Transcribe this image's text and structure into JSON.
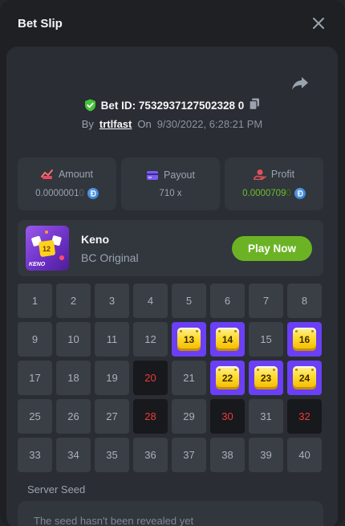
{
  "modal": {
    "title": "Bet Slip"
  },
  "bet": {
    "id_label": "Bet ID: 7532937127502328 0",
    "by_label": "By",
    "username": "trtlfast",
    "on_label": "On",
    "date": "9/30/2022, 6:28:21 PM"
  },
  "stats": {
    "amount": {
      "label": "Amount",
      "value_main": "0.0000001",
      "value_tail": "0"
    },
    "payout": {
      "label": "Payout",
      "value": "710 x"
    },
    "profit": {
      "label": "Profit",
      "value_main": "0.0000709",
      "value_tail": "0"
    }
  },
  "game": {
    "name": "Keno",
    "subtitle": "BC Original",
    "play_label": "Play Now",
    "thumb_text": "KENO"
  },
  "grid": {
    "cells": [
      {
        "n": "1",
        "state": "normal"
      },
      {
        "n": "2",
        "state": "normal"
      },
      {
        "n": "3",
        "state": "normal"
      },
      {
        "n": "4",
        "state": "normal"
      },
      {
        "n": "5",
        "state": "normal"
      },
      {
        "n": "6",
        "state": "normal"
      },
      {
        "n": "7",
        "state": "normal"
      },
      {
        "n": "8",
        "state": "normal"
      },
      {
        "n": "9",
        "state": "normal"
      },
      {
        "n": "10",
        "state": "normal"
      },
      {
        "n": "11",
        "state": "normal"
      },
      {
        "n": "12",
        "state": "normal"
      },
      {
        "n": "13",
        "state": "hit"
      },
      {
        "n": "14",
        "state": "hit"
      },
      {
        "n": "15",
        "state": "normal"
      },
      {
        "n": "16",
        "state": "hit"
      },
      {
        "n": "17",
        "state": "normal"
      },
      {
        "n": "18",
        "state": "normal"
      },
      {
        "n": "19",
        "state": "normal"
      },
      {
        "n": "20",
        "state": "drawn"
      },
      {
        "n": "21",
        "state": "normal"
      },
      {
        "n": "22",
        "state": "hit"
      },
      {
        "n": "23",
        "state": "hit"
      },
      {
        "n": "24",
        "state": "hit"
      },
      {
        "n": "25",
        "state": "normal"
      },
      {
        "n": "26",
        "state": "normal"
      },
      {
        "n": "27",
        "state": "normal"
      },
      {
        "n": "28",
        "state": "drawn"
      },
      {
        "n": "29",
        "state": "normal"
      },
      {
        "n": "30",
        "state": "drawn"
      },
      {
        "n": "31",
        "state": "normal"
      },
      {
        "n": "32",
        "state": "drawn"
      },
      {
        "n": "33",
        "state": "normal"
      },
      {
        "n": "34",
        "state": "normal"
      },
      {
        "n": "35",
        "state": "normal"
      },
      {
        "n": "36",
        "state": "normal"
      },
      {
        "n": "37",
        "state": "normal"
      },
      {
        "n": "38",
        "state": "normal"
      },
      {
        "n": "39",
        "state": "normal"
      },
      {
        "n": "40",
        "state": "normal"
      }
    ]
  },
  "seed": {
    "label": "Server Seed",
    "text": "The seed hasn't been revealed yet"
  },
  "colors": {
    "accent_green": "#6bb324",
    "hit_purple": "#6a3ff5",
    "drawn_red": "#ed3a3a",
    "verified_green": "#46c23a"
  }
}
